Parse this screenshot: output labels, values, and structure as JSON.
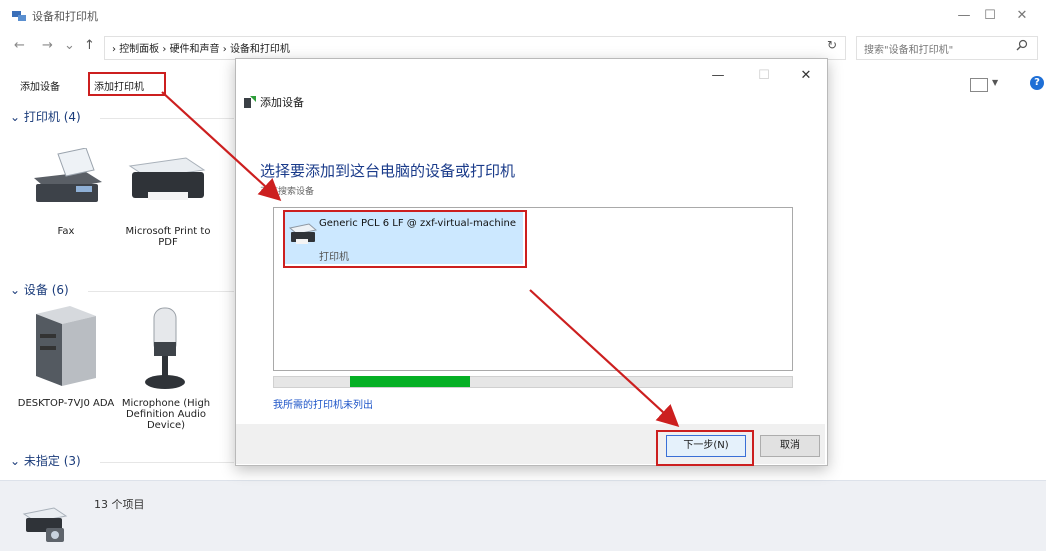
{
  "window": {
    "title": "设备和打印机"
  },
  "nav": {
    "back": "←",
    "forward": "→",
    "recent": "⌄",
    "up": "↑",
    "breadcrumbs": [
      "控制面板",
      "硬件和声音",
      "设备和打印机"
    ],
    "breadcrumb_sep": "›",
    "refresh": "↻",
    "search_placeholder": "搜索\"设备和打印机\""
  },
  "commands": {
    "add_device": "添加设备",
    "add_printer": "添加打印机"
  },
  "sections": {
    "printers": {
      "header": "打印机 (4)",
      "items": [
        "Fax",
        "Microsoft Print to PDF"
      ]
    },
    "devices": {
      "header": "设备 (6)",
      "items": [
        "DESKTOP-7VJ0 ADA",
        "Microphone (High Definition Audio Device)"
      ]
    },
    "unspecified": {
      "header": "未指定 (3)"
    }
  },
  "status": {
    "count": "13 个项目"
  },
  "dialog": {
    "title": "添加设备",
    "heading": "选择要添加到这台电脑的设备或打印机",
    "subheading": "正在搜索设备",
    "item": {
      "name": "Generic PCL 6 LF @ zxf-virtual-machine",
      "type": "打印机"
    },
    "progress": 0.23,
    "not_listed": "我所需的打印机未列出",
    "next_button": "下一步(N)",
    "cancel_button": "取消"
  },
  "colors": {
    "annotation": "#cc1f1f",
    "progress": "#06b025",
    "link": "#1e55c8"
  }
}
